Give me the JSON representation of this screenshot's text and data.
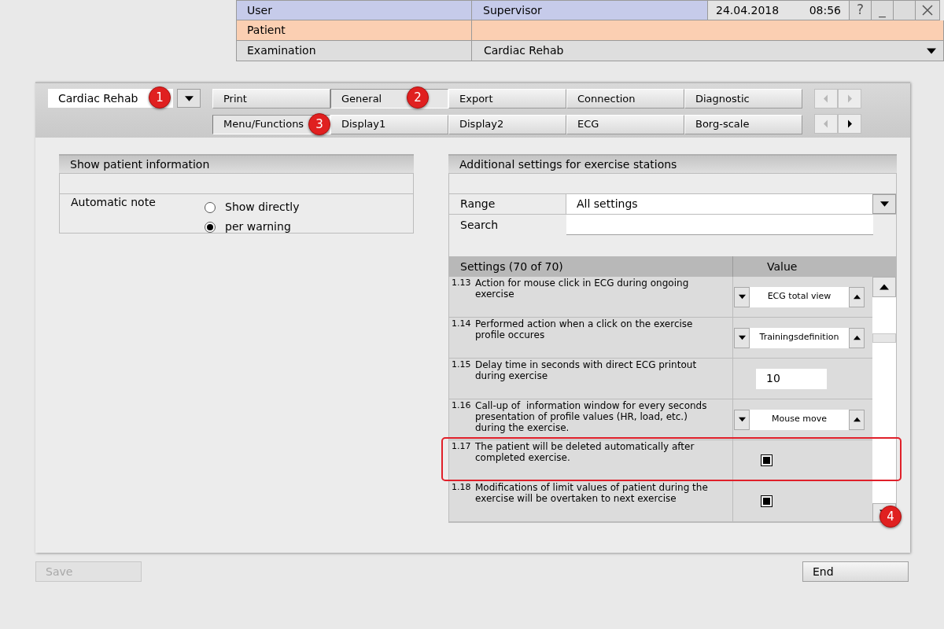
{
  "header": {
    "user_label": "User",
    "user": "Supervisor",
    "date": "24.04.2018",
    "time": "08:56",
    "patient_label": "Patient",
    "examination_label": "Examination",
    "examination": "Cardiac Rehab",
    "window_buttons": [
      {
        "kind": "help",
        "label": "?"
      },
      {
        "kind": "minimize",
        "label": "_"
      },
      {
        "kind": "blank"
      },
      {
        "kind": "close"
      }
    ]
  },
  "profile_selector": {
    "value": "Cardiac Rehab",
    "callout": "1"
  },
  "tab_rows": [
    {
      "tabs": [
        {
          "label": "Print",
          "selected": false
        },
        {
          "label": "General",
          "selected": true,
          "callout": "2"
        },
        {
          "label": "Export",
          "selected": false
        },
        {
          "label": "Connection",
          "selected": false
        },
        {
          "label": "Diagnostic",
          "selected": false
        }
      ],
      "prev_disabled": true,
      "next_disabled": true
    },
    {
      "tabs": [
        {
          "label": "Menu/Functions",
          "selected": true,
          "callout": "3"
        },
        {
          "label": "Display1",
          "selected": false
        },
        {
          "label": "Display2",
          "selected": false
        },
        {
          "label": "ECG",
          "selected": false
        },
        {
          "label": "Borg-scale",
          "selected": false
        }
      ],
      "prev_disabled": true,
      "next_disabled": false
    }
  ],
  "patient_info": {
    "title": "Show patient information",
    "label": "Automatic note",
    "options": [
      {
        "label": "Show directly",
        "selected": false
      },
      {
        "label": "per warning",
        "selected": true
      }
    ]
  },
  "exercise_settings": {
    "title": "Additional settings for exercise stations",
    "range_label": "Range",
    "range_value": "All settings",
    "search_label": "Search",
    "columns": [
      "Settings (70 of 70)",
      "Value"
    ],
    "rows": [
      {
        "number": "1.13",
        "text": "Action for mouse click in ECG during ongoing exercise",
        "kind": "spinner",
        "value": "ECG total view",
        "highlighted": false
      },
      {
        "number": "1.14",
        "text": "Performed action when a click on the exercise profile occures",
        "kind": "spinner",
        "value": "Trainingsdefinition",
        "highlighted": false
      },
      {
        "number": "1.15",
        "text": "Delay time in seconds with direct ECG printout during exercise",
        "kind": "number",
        "value": "10",
        "highlighted": false
      },
      {
        "number": "1.16",
        "text": "Call-up of  information window for every seconds presentation of profile values (HR, load, etc.) during the exercise.",
        "kind": "spinner",
        "value": "Mouse move",
        "highlighted": false
      },
      {
        "number": "1.17",
        "text": "The patient will be deleted automatically after completed exercise.",
        "kind": "checkbox",
        "checked": true,
        "highlighted": true
      },
      {
        "number": "1.18",
        "text": "Modifications of limit values of patient during the exercise will be overtaken to next exercise",
        "kind": "checkbox",
        "checked": true,
        "highlighted": false
      }
    ],
    "scrollbar_callout": "4"
  },
  "buttons": [
    {
      "label": "Save",
      "disabled": true
    },
    {
      "label": "End",
      "disabled": false
    }
  ]
}
